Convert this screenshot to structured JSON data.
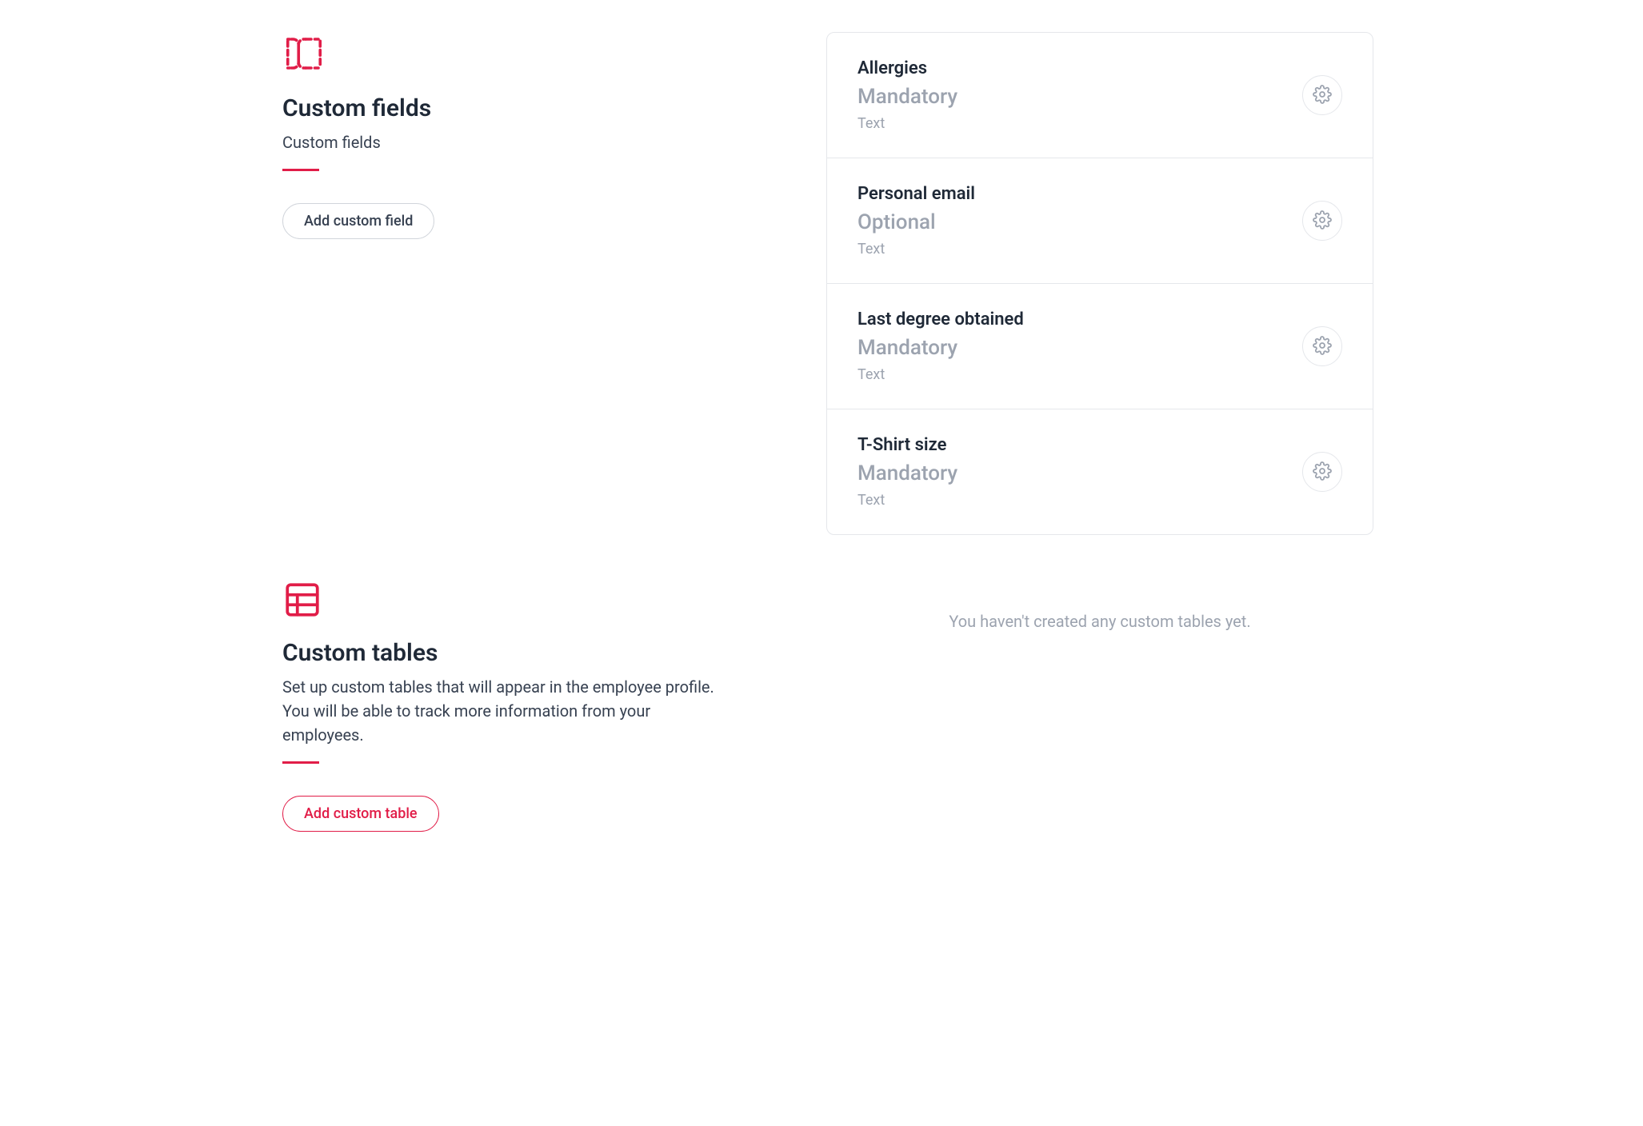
{
  "custom_fields_section": {
    "title": "Custom fields",
    "subtitle": "Custom fields",
    "add_button_label": "Add custom field"
  },
  "custom_fields": [
    {
      "name": "Allergies",
      "requirement": "Mandatory",
      "type": "Text"
    },
    {
      "name": "Personal email",
      "requirement": "Optional",
      "type": "Text"
    },
    {
      "name": "Last degree obtained",
      "requirement": "Mandatory",
      "type": "Text"
    },
    {
      "name": "T-Shirt size",
      "requirement": "Mandatory",
      "type": "Text"
    }
  ],
  "custom_tables_section": {
    "title": "Custom tables",
    "subtitle": "Set up custom tables that will appear in the employee profile. You will be able to track more information from your employees.",
    "add_button_label": "Add custom table",
    "empty_state": "You haven't created any custom tables yet."
  },
  "colors": {
    "accent": "#e11d48"
  }
}
